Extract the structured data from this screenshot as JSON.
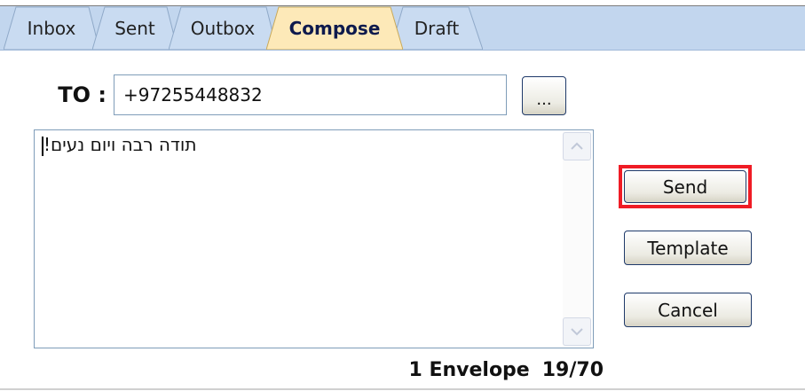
{
  "tabs": [
    {
      "label": "Inbox",
      "active": false
    },
    {
      "label": "Sent",
      "active": false
    },
    {
      "label": "Outbox",
      "active": false
    },
    {
      "label": "Compose",
      "active": true
    },
    {
      "label": "Draft",
      "active": false
    }
  ],
  "compose": {
    "to_label": "TO :",
    "to_value": "+97255448832",
    "browse_label": "...",
    "message": "תודה רבה ויום נעים!"
  },
  "actions": {
    "send": "Send",
    "template": "Template",
    "cancel": "Cancel"
  },
  "status": {
    "envelopes": "1 Envelope",
    "char_count": "19/70"
  },
  "colors": {
    "tab_bar": "#c2d6ee",
    "active_tab": "#fde9b8",
    "highlight": "#ef1c25"
  }
}
